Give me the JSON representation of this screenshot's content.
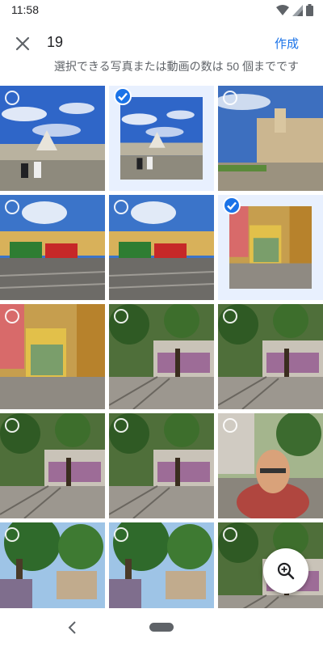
{
  "status": {
    "time": "11:58"
  },
  "header": {
    "selected_count": "19",
    "create_label": "作成"
  },
  "info": {
    "limit_text": "選択できる写真または動画の数は 50 個までです"
  },
  "photos": [
    {
      "selected": false,
      "scene": "plaza"
    },
    {
      "selected": true,
      "scene": "plaza"
    },
    {
      "selected": false,
      "scene": "monastery"
    },
    {
      "selected": false,
      "scene": "tram-square"
    },
    {
      "selected": false,
      "scene": "tram-square"
    },
    {
      "selected": true,
      "scene": "tram-street"
    },
    {
      "selected": false,
      "scene": "tram-street"
    },
    {
      "selected": false,
      "scene": "graffiti-street"
    },
    {
      "selected": false,
      "scene": "graffiti-street"
    },
    {
      "selected": false,
      "scene": "graffiti-street"
    },
    {
      "selected": false,
      "scene": "graffiti-street"
    },
    {
      "selected": false,
      "scene": "selfie"
    },
    {
      "selected": false,
      "scene": "tree-alley"
    },
    {
      "selected": false,
      "scene": "tree-alley"
    },
    {
      "selected": false,
      "scene": "graffiti-street"
    }
  ],
  "icons": {
    "close": "close-icon",
    "zoom": "zoom-in-icon",
    "back": "back-nav-icon"
  }
}
